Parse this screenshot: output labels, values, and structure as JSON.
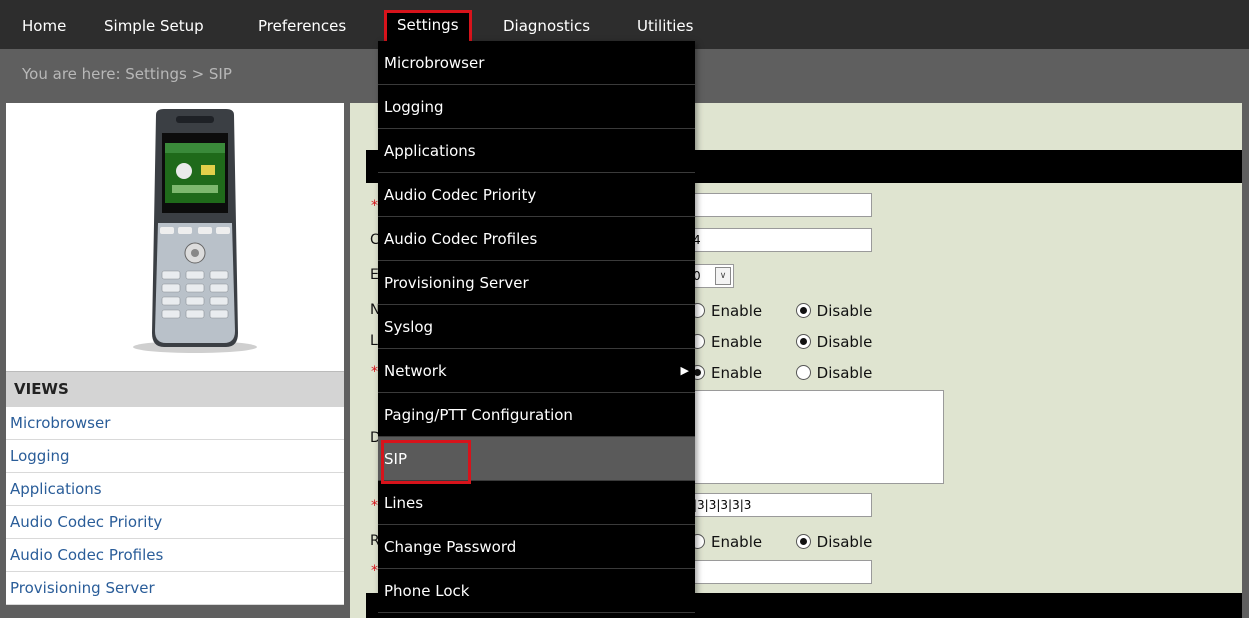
{
  "nav": {
    "items": [
      "Home",
      "Simple Setup",
      "Preferences",
      "Settings",
      "Diagnostics",
      "Utilities"
    ],
    "active": "Settings"
  },
  "breadcrumb": "You are here: Settings > SIP",
  "views": {
    "header": "VIEWS",
    "items": [
      "Microbrowser",
      "Logging",
      "Applications",
      "Audio Codec Priority",
      "Audio Codec Profiles",
      "Provisioning Server"
    ]
  },
  "dropdown": {
    "items": [
      "Microbrowser",
      "Logging",
      "Applications",
      "Audio Codec Priority",
      "Audio Codec Profiles",
      "Provisioning Server",
      "Syslog",
      "Network",
      "Paging/PTT Configuration",
      "SIP",
      "Lines",
      "Change Password",
      "Phone Lock"
    ],
    "submenu_item": "Network",
    "selected": "SIP"
  },
  "form": {
    "field2_value": "4",
    "select_value": "0",
    "field_code_value": "|3|3|3|3|3",
    "radio_enable": "Enable",
    "radio_disable": "Disable",
    "label_letters": [
      "C",
      "E",
      "N",
      "L",
      "D",
      "R"
    ]
  },
  "colors": {
    "accent": "#d7131b",
    "link": "#2a5d99",
    "topbar": "#2d2d2d",
    "panel": "#dfe4d0"
  }
}
